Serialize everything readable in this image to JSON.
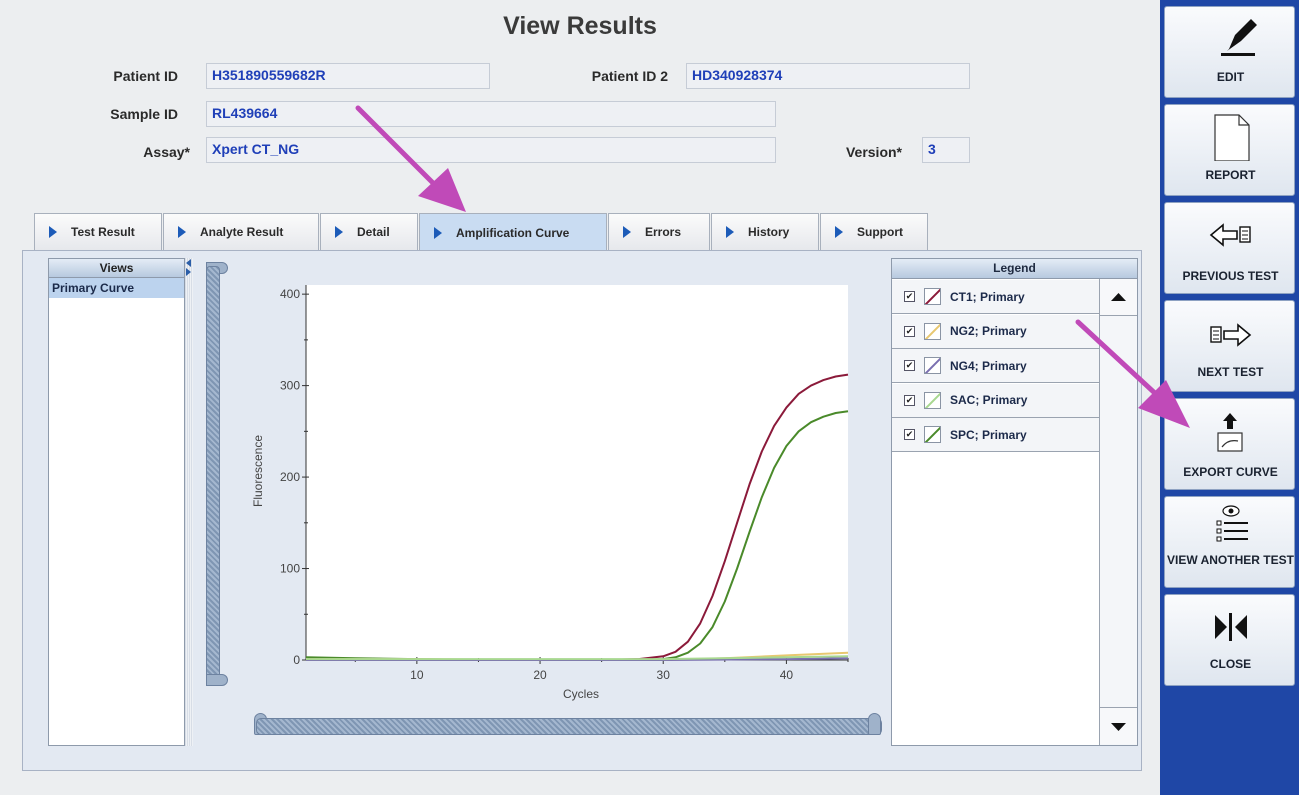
{
  "window": {
    "title": "View Results"
  },
  "patient": {
    "id_label": "Patient ID",
    "id_value": "H351890559682R",
    "id2_label": "Patient ID 2",
    "id2_value": "HD340928374",
    "sample_label": "Sample ID",
    "sample_value": "RL439664",
    "assay_label": "Assay*",
    "assay_value": "Xpert CT_NG",
    "version_label": "Version*",
    "version_value": "3"
  },
  "tabs": [
    {
      "label": "Test Result"
    },
    {
      "label": "Analyte Result"
    },
    {
      "label": "Detail"
    },
    {
      "label": "Amplification Curve",
      "active": true
    },
    {
      "label": "Errors"
    },
    {
      "label": "History"
    },
    {
      "label": "Support"
    }
  ],
  "views": {
    "header": "Views",
    "items": [
      "Primary Curve"
    ]
  },
  "legend": {
    "header": "Legend",
    "items": [
      {
        "label": "CT1; Primary",
        "checked": true,
        "color": "#8b1a3a"
      },
      {
        "label": "NG2; Primary",
        "checked": true,
        "color": "#e8c870"
      },
      {
        "label": "NG4; Primary",
        "checked": true,
        "color": "#7a6fb0"
      },
      {
        "label": "SAC; Primary",
        "checked": true,
        "color": "#a8d890"
      },
      {
        "label": "SPC; Primary",
        "checked": true,
        "color": "#4a8a2a"
      }
    ]
  },
  "chart_data": {
    "type": "line",
    "xlabel": "Cycles",
    "ylabel": "Fluorescence",
    "xlim": [
      1,
      45
    ],
    "ylim": [
      0,
      410
    ],
    "x_ticks": [
      10,
      20,
      30,
      40
    ],
    "y_ticks": [
      0,
      100,
      200,
      300,
      400
    ],
    "series": [
      {
        "name": "CT1; Primary",
        "color": "#8b1a3a",
        "x": [
          1,
          5,
          10,
          15,
          20,
          25,
          28,
          30,
          31,
          32,
          33,
          34,
          35,
          36,
          37,
          38,
          39,
          40,
          41,
          42,
          43,
          44,
          45
        ],
        "y": [
          2,
          1,
          0,
          0,
          0,
          0,
          1,
          4,
          9,
          20,
          40,
          70,
          108,
          150,
          192,
          228,
          256,
          276,
          291,
          300,
          306,
          310,
          312
        ]
      },
      {
        "name": "SPC; Primary",
        "color": "#4a8a2a",
        "x": [
          1,
          5,
          10,
          15,
          20,
          25,
          28,
          30,
          31,
          32,
          33,
          34,
          35,
          36,
          37,
          38,
          39,
          40,
          41,
          42,
          43,
          44,
          45
        ],
        "y": [
          3,
          2,
          1,
          0,
          0,
          0,
          0,
          1,
          3,
          8,
          18,
          36,
          64,
          100,
          140,
          178,
          210,
          234,
          250,
          260,
          266,
          270,
          272
        ]
      },
      {
        "name": "NG2; Primary",
        "color": "#e8c870",
        "x": [
          1,
          10,
          20,
          30,
          35,
          40,
          45
        ],
        "y": [
          1,
          1,
          0,
          0,
          2,
          5,
          8
        ]
      },
      {
        "name": "NG4; Primary",
        "color": "#7a6fb0",
        "x": [
          1,
          10,
          20,
          30,
          40,
          45
        ],
        "y": [
          0,
          0,
          0,
          0,
          1,
          2
        ]
      },
      {
        "name": "SAC; Primary",
        "color": "#a8d890",
        "x": [
          1,
          10,
          20,
          30,
          40,
          45
        ],
        "y": [
          1,
          1,
          1,
          1,
          3,
          4
        ]
      }
    ]
  },
  "sidebar": {
    "edit": "EDIT",
    "report": "REPORT",
    "previous_test": "PREVIOUS TEST",
    "next_test": "NEXT TEST",
    "export_curve": "EXPORT CURVE",
    "view_another_test": "VIEW ANOTHER TEST",
    "close": "CLOSE"
  },
  "annotation_color": "#c04ab8"
}
